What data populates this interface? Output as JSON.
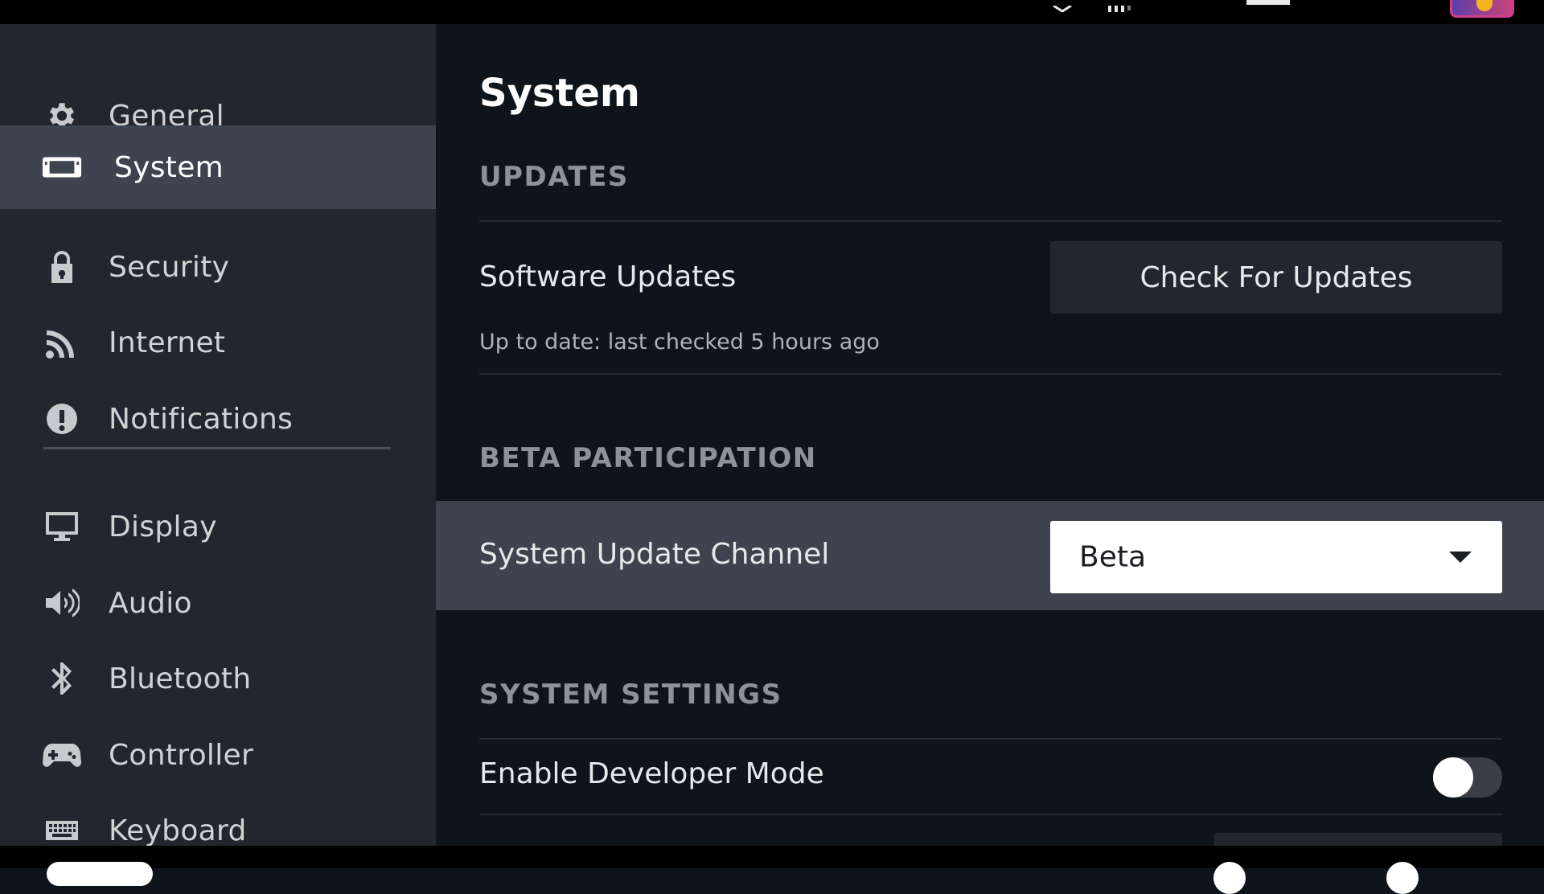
{
  "sidebar": {
    "items": [
      {
        "label": "General",
        "icon": "gear-icon"
      },
      {
        "label": "System",
        "icon": "handheld-device-icon",
        "active": true
      },
      {
        "label": "Security",
        "icon": "lock-icon"
      },
      {
        "label": "Internet",
        "icon": "wifi-signal-icon"
      },
      {
        "label": "Notifications",
        "icon": "alert-circle-icon"
      },
      {
        "label": "Display",
        "icon": "monitor-icon"
      },
      {
        "label": "Audio",
        "icon": "speaker-icon"
      },
      {
        "label": "Bluetooth",
        "icon": "bluetooth-icon"
      },
      {
        "label": "Controller",
        "icon": "gamepad-icon"
      },
      {
        "label": "Keyboard",
        "icon": "keyboard-icon"
      }
    ]
  },
  "main": {
    "title": "System",
    "updates": {
      "heading": "UPDATES",
      "software_updates_label": "Software Updates",
      "check_button_label": "Check For Updates",
      "status": "Up to date: last checked 5 hours ago"
    },
    "beta": {
      "heading": "BETA PARTICIPATION",
      "channel_label": "System Update Channel",
      "channel_value": "Beta"
    },
    "system_settings": {
      "heading": "SYSTEM SETTINGS",
      "developer_mode_label": "Enable Developer Mode",
      "developer_mode_enabled": false
    }
  },
  "colors": {
    "sidebar_bg": "#23262e",
    "active_bg": "#3d4450",
    "main_bg": "#0e141b",
    "heading": "#8b929a",
    "avatar_border": "#d43b8e"
  }
}
